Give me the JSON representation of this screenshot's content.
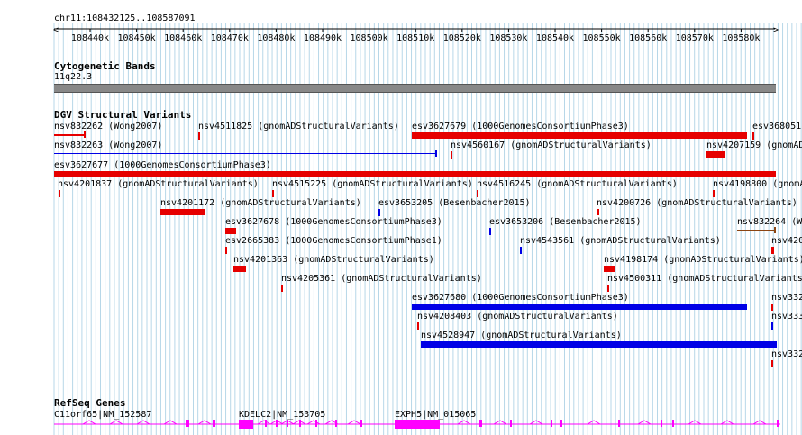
{
  "locus": "chr11:108432125..108587091",
  "ruler": {
    "ticks": [
      "108440k",
      "108450k",
      "108460k",
      "108470k",
      "108480k",
      "108490k",
      "108500k",
      "108510k",
      "108520k",
      "108530k",
      "108540k",
      "108550k",
      "108560k",
      "108570k",
      "108580k"
    ]
  },
  "colors": {
    "deletion": "#e60000",
    "gain": "#0000e6",
    "gene": "#ff00ff",
    "complex": "#8b4513",
    "grid": "#b7d7e8"
  },
  "tracks": {
    "cyto": {
      "title": "Cytogenetic Bands",
      "band": "11q22.3"
    },
    "dgv": {
      "title": "DGV Structural Variants",
      "features": [
        {
          "label": "nsv832262 (Wong2007)",
          "type": "deletion"
        },
        {
          "label": "nsv4511825 (gnomADStructuralVariants)",
          "type": "deletion"
        },
        {
          "label": "esv3627679 (1000GenomesConsortiumPhase3)",
          "type": "deletion"
        },
        {
          "label": "esv368051",
          "type": "deletion"
        },
        {
          "label": "nsv832263 (Wong2007)",
          "type": "gain"
        },
        {
          "label": "nsv4560167 (gnomADStructuralVariants)",
          "type": "deletion"
        },
        {
          "label": "nsv4207159 (gnomAD",
          "type": "deletion"
        },
        {
          "label": "esv3627677 (1000GenomesConsortiumPhase3)",
          "type": "deletion"
        },
        {
          "label": "nsv4201837 (gnomADStructuralVariants)",
          "type": "deletion"
        },
        {
          "label": "nsv4515225 (gnomADStructuralVariants)",
          "type": "deletion"
        },
        {
          "label": "nsv4516245 (gnomADStructuralVariants)",
          "type": "deletion"
        },
        {
          "label": "nsv4198800 (gnomADStr",
          "type": "deletion"
        },
        {
          "label": "nsv4201172 (gnomADStructuralVariants)",
          "type": "deletion"
        },
        {
          "label": "esv3653205 (Besenbacher2015)",
          "type": "gain"
        },
        {
          "label": "nsv4200726 (gnomADStructuralVariants)",
          "type": "deletion"
        },
        {
          "label": "esv3627678 (1000GenomesConsortiumPhase3)",
          "type": "deletion"
        },
        {
          "label": "esv3653206 (Besenbacher2015)",
          "type": "gain"
        },
        {
          "label": "nsv832264 (Wo",
          "type": "complex"
        },
        {
          "label": "esv2665383 (1000GenomesConsortiumPhase1)",
          "type": "deletion"
        },
        {
          "label": "nsv4543561 (gnomADStructuralVariants)",
          "type": "gain"
        },
        {
          "label": "nsv420",
          "type": "deletion"
        },
        {
          "label": "nsv4201363 (gnomADStructuralVariants)",
          "type": "deletion"
        },
        {
          "label": "nsv4198174 (gnomADStructuralVariants)",
          "type": "deletion"
        },
        {
          "label": "nsv4205361 (gnomADStructuralVariants)",
          "type": "deletion"
        },
        {
          "label": "nsv4500311 (gnomADStructuralVariants)",
          "type": "deletion"
        },
        {
          "label": "esv3627680 (1000GenomesConsortiumPhase3)",
          "type": "gain"
        },
        {
          "label": "nsv332",
          "type": "deletion"
        },
        {
          "label": "nsv4208403 (gnomADStructuralVariants)",
          "type": "deletion"
        },
        {
          "label": "nsv333",
          "type": "gain"
        },
        {
          "label": "nsv4528947 (gnomADStructuralVariants)",
          "type": "gain"
        },
        {
          "label": "nsv332",
          "type": "deletion"
        },
        {
          "label": "",
          "type": "deletion"
        }
      ]
    },
    "refseq": {
      "title": "RefSeq Genes",
      "genes": [
        {
          "label": "C11orf65|NM_152587"
        },
        {
          "label": "KDELC2|NM_153705"
        },
        {
          "label": "EXPH5|NM_015065"
        }
      ]
    }
  }
}
